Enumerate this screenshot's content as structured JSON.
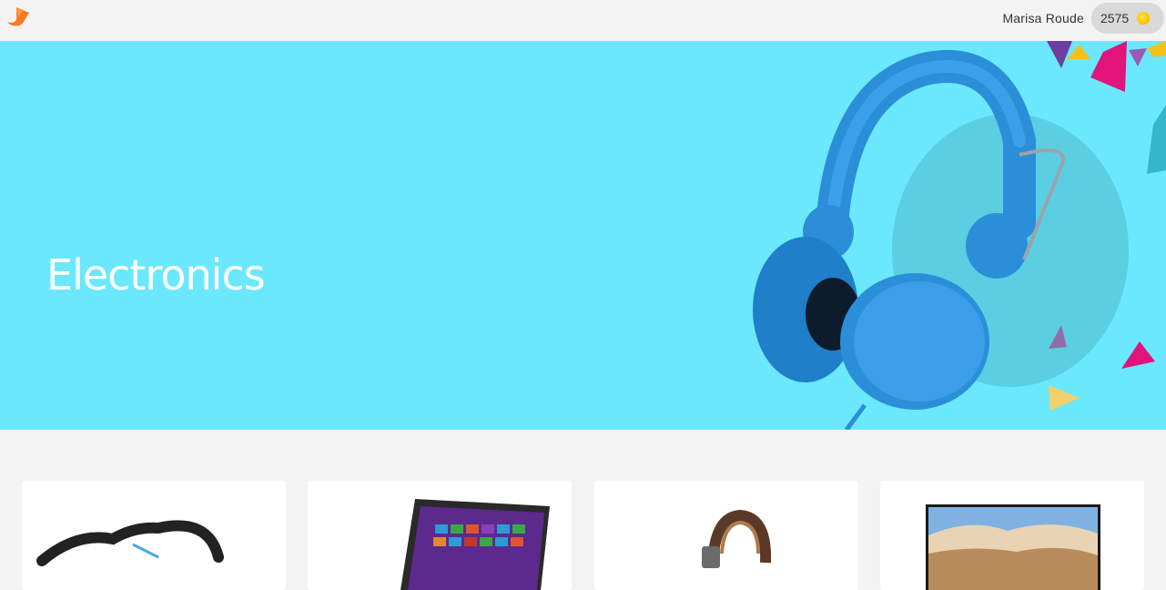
{
  "header": {
    "user_name": "Marisa Roude",
    "points": "2575",
    "logo_icon": "orange-bird-logo",
    "coin_icon": "coin-icon"
  },
  "hero": {
    "title": "Electronics",
    "background_color": "#6be8fd",
    "image": "blue-headphones"
  },
  "products": [
    {
      "image": "black-headset"
    },
    {
      "image": "windows-tablet"
    },
    {
      "image": "leather-headphones"
    },
    {
      "image": "flat-screen-tv"
    }
  ]
}
